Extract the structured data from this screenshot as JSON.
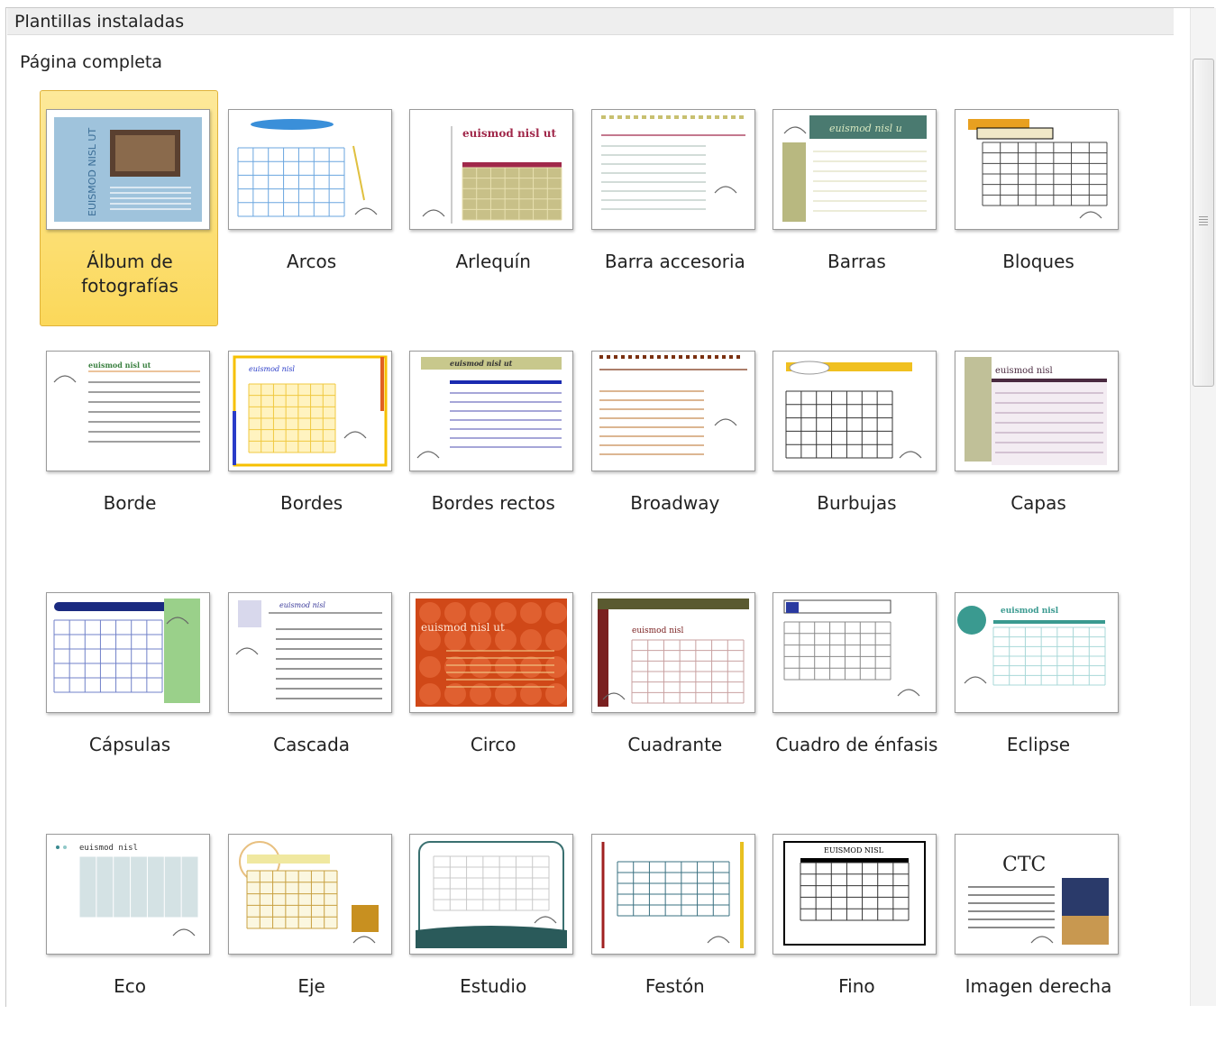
{
  "header": {
    "title": "Plantillas instaladas"
  },
  "section": {
    "title": "Página completa"
  },
  "templates": [
    {
      "name": "Álbum de fotografías",
      "thumb_text": "EUISMOD NISL UT"
    },
    {
      "name": "Arcos"
    },
    {
      "name": "Arlequín",
      "thumb_text": "euismod nisl ut"
    },
    {
      "name": "Barra accesoria"
    },
    {
      "name": "Barras",
      "thumb_text": "euismod nisl u"
    },
    {
      "name": "Bloques"
    },
    {
      "name": "Borde",
      "thumb_text": "euismod nisl ut"
    },
    {
      "name": "Bordes",
      "thumb_text": "euismod nisl"
    },
    {
      "name": "Bordes rectos",
      "thumb_text": "euismod nisl ut"
    },
    {
      "name": "Broadway"
    },
    {
      "name": "Burbujas"
    },
    {
      "name": "Capas",
      "thumb_text": "euismod nisl"
    },
    {
      "name": "Cápsulas"
    },
    {
      "name": "Cascada",
      "thumb_text": "euismod nisl"
    },
    {
      "name": "Circo",
      "thumb_text": "euismod nisl ut"
    },
    {
      "name": "Cuadrante",
      "thumb_text": "euismod nisl"
    },
    {
      "name": "Cuadro de énfasis"
    },
    {
      "name": "Eclipse",
      "thumb_text": "euismod nisl"
    },
    {
      "name": "Eco",
      "thumb_text": "euismod nisl"
    },
    {
      "name": "Eje"
    },
    {
      "name": "Estudio"
    },
    {
      "name": "Festón"
    },
    {
      "name": "Fino",
      "thumb_text": "EUISMOD NISL"
    },
    {
      "name": "Imagen derecha",
      "thumb_text": "CTC"
    }
  ],
  "selected_index": 0,
  "colors": {
    "selection": "#fbd85a",
    "selection_border": "#e0b23a"
  }
}
